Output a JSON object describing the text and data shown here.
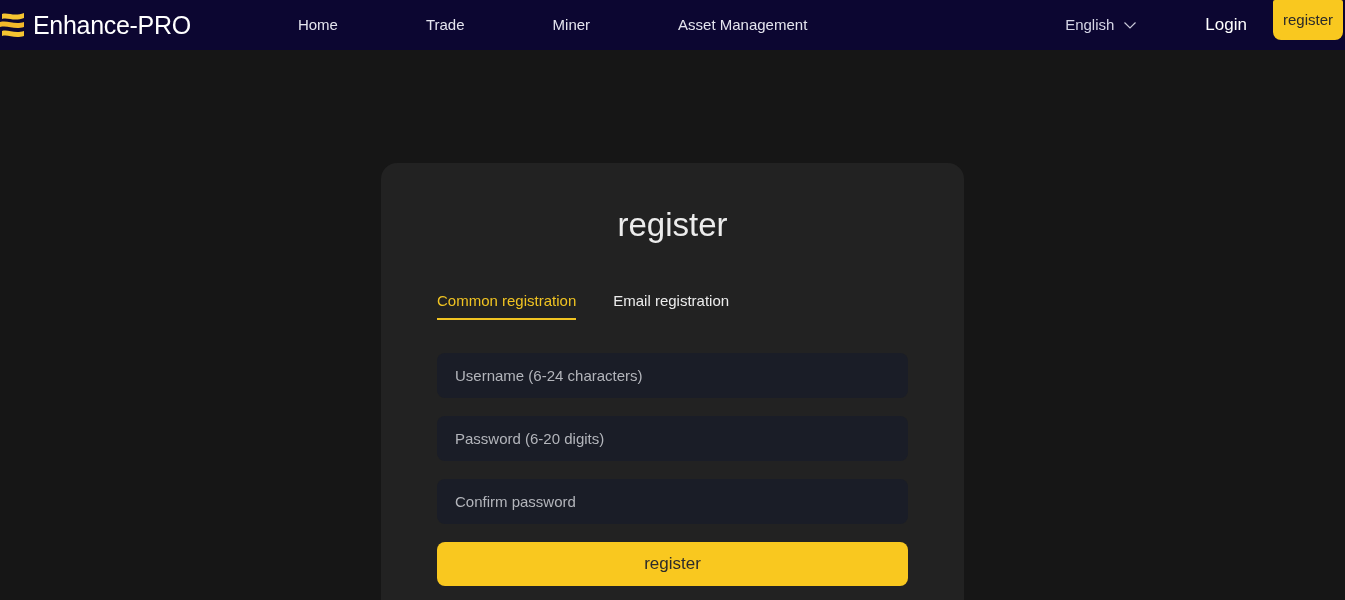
{
  "header": {
    "logo_text": "Enhance-PRO",
    "nav": [
      "Home",
      "Trade",
      "Miner",
      "Asset Management"
    ],
    "language": "English",
    "login": "Login",
    "register": "register"
  },
  "form": {
    "title": "register",
    "tabs": [
      {
        "label": "Common registration",
        "selected": true
      },
      {
        "label": "Email registration",
        "selected": false
      }
    ],
    "fields": [
      {
        "placeholder": "Username (6-24 characters)"
      },
      {
        "placeholder": "Password (6-20 digits)"
      },
      {
        "placeholder": "Confirm password"
      }
    ],
    "submit": "register"
  }
}
